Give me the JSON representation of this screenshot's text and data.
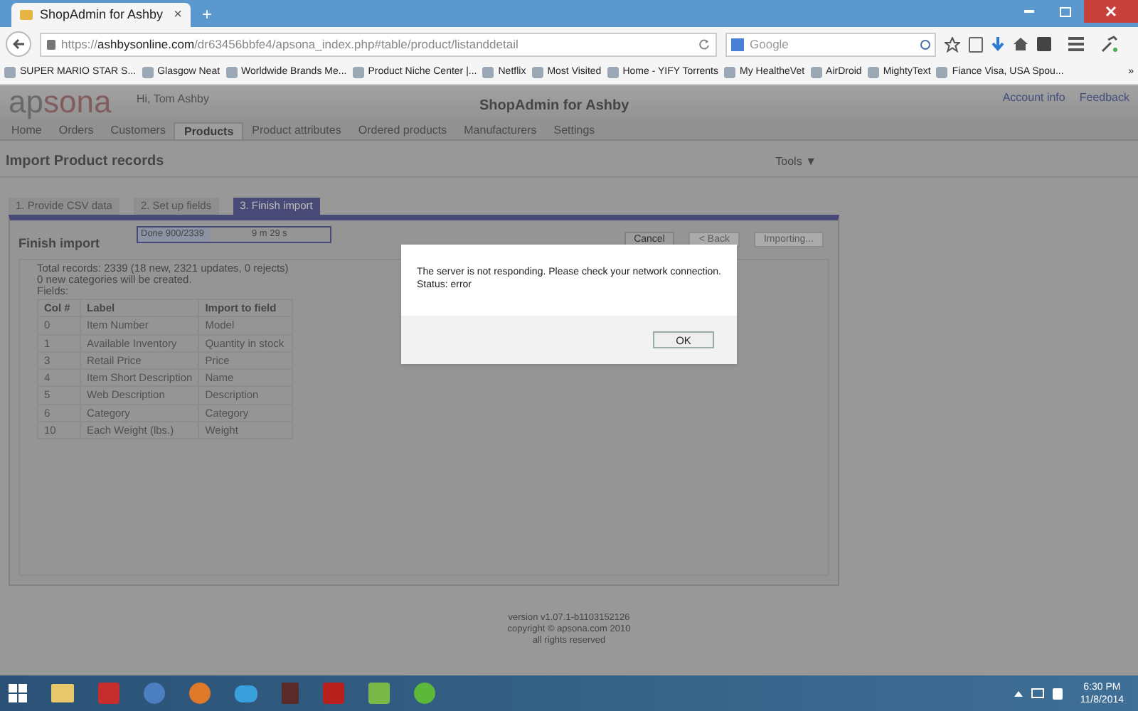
{
  "browser": {
    "tab_title": "ShopAdmin for Ashby",
    "tab_close": "×",
    "new_tab": "+",
    "url_prefix": "https://",
    "url_host": "ashbysonline.com",
    "url_path": "/dr63456bbfe4/apsona_index.php#table/product/listanddetail",
    "search_placeholder": "Google",
    "bookmarks": [
      "SUPER MARIO STAR S...",
      "Glasgow Neat",
      "Worldwide Brands Me...",
      "Product Niche Center |...",
      "Netflix",
      "Most Visited",
      "Home - YIFY Torrents",
      "My HealtheVet",
      "AirDroid",
      "MightyText",
      "Fiance Visa, USA Spou..."
    ],
    "bookmarks_more": "»"
  },
  "header": {
    "logo_ap": "ap",
    "logo_sona": "sona",
    "greeting": "Hi, Tom Ashby",
    "title": "ShopAdmin for Ashby",
    "links": [
      "Account info",
      "Feedback"
    ]
  },
  "nav": [
    {
      "label": "Home",
      "selected": false
    },
    {
      "label": "Orders",
      "selected": false
    },
    {
      "label": "Customers",
      "selected": false
    },
    {
      "label": "Products",
      "selected": true
    },
    {
      "label": "Product attributes",
      "selected": false
    },
    {
      "label": "Ordered products",
      "selected": false
    },
    {
      "label": "Manufacturers",
      "selected": false
    },
    {
      "label": "Settings",
      "selected": false
    }
  ],
  "page_title": "Import Product records",
  "tools": "Tools",
  "tools_caret": "▼",
  "steps": [
    {
      "label": "1. Provide CSV data",
      "selected": false
    },
    {
      "label": "2. Set up fields",
      "selected": false
    },
    {
      "label": "3. Finish import",
      "selected": true
    }
  ],
  "panel": {
    "title": "Finish import",
    "progress": {
      "label": "Done 900/2339",
      "level": 0.38,
      "time": "9 m 29 s"
    },
    "buttons": [
      {
        "label": "Cancel",
        "disabled": false
      },
      {
        "label": "< Back",
        "disabled": true
      },
      {
        "label": "Importing...",
        "disabled": true
      }
    ],
    "summary": [
      "Total records: 2339 (18 new, 2321 updates, 0 rejects)",
      "0 new categories will be created.",
      "Fields:"
    ],
    "table": {
      "columns": [
        "Col #",
        "Label",
        "Import to field"
      ],
      "rows": [
        [
          "0",
          "Item Number",
          "Model"
        ],
        [
          "1",
          "Available Inventory",
          "Quantity in stock"
        ],
        [
          "3",
          "Retail Price",
          "Price"
        ],
        [
          "4",
          "Item Short Description",
          "Name"
        ],
        [
          "5",
          "Web Description",
          "Description"
        ],
        [
          "6",
          "Category",
          "Category"
        ],
        [
          "10",
          "Each Weight (lbs.)",
          "Weight"
        ]
      ]
    }
  },
  "footer": [
    "version v1.07.1-b1103152126",
    "copyright © apsona.com 2010",
    "all rights reserved"
  ],
  "dialog": {
    "message": "The server is not responding. Please check your network connection.",
    "status": "Status: error",
    "button": "OK"
  },
  "taskbar": {
    "time": "6:30 PM",
    "date": "11/8/2014"
  }
}
